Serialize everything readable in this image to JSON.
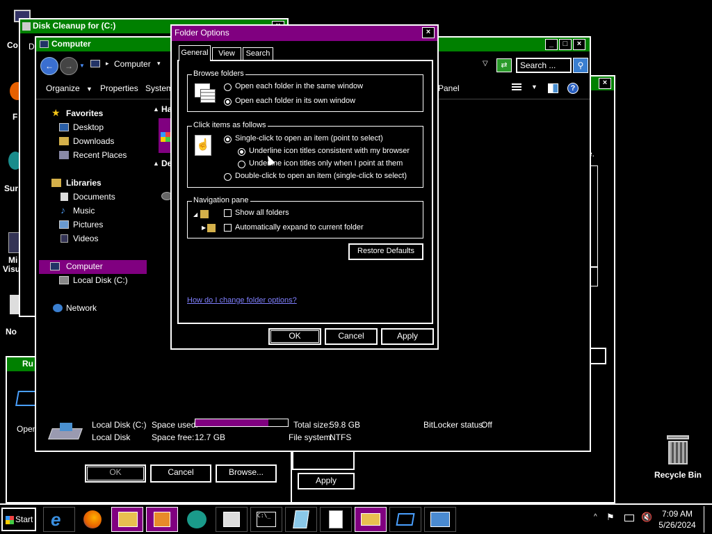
{
  "desktop": {
    "recycle_bin_label": "Recycle Bin",
    "left_icon_fragments": [
      "Co",
      "F",
      "Sur",
      "Mi",
      "Visu",
      "No"
    ]
  },
  "disk_cleanup": {
    "title": "Disk Cleanup for  (C:)",
    "fragment_d": "D"
  },
  "run_dialog": {
    "title": "Ru",
    "open_label": "Open",
    "ok_label": "OK",
    "cancel_label": "Cancel",
    "browse_label": "Browse..."
  },
  "behind_dialog": {
    "apply_label": "Apply",
    "fragment_e": "e."
  },
  "explorer": {
    "title": "Computer",
    "address_label": "Computer",
    "search_placeholder": "Search ...",
    "toolbar": {
      "organize": "Organize",
      "properties": "Properties",
      "system": "System",
      "control_panel_fragment": "l Panel"
    },
    "nav": {
      "favorites": "Favorites",
      "desktop": "Desktop",
      "downloads": "Downloads",
      "recent_places": "Recent Places",
      "libraries": "Libraries",
      "documents": "Documents",
      "music": "Music",
      "pictures": "Pictures",
      "videos": "Videos",
      "computer": "Computer",
      "local_disk": "Local Disk (C:)",
      "network": "Network"
    },
    "content_fragments": {
      "ha": "Ha",
      "de": "De"
    },
    "details": {
      "drive_name": "Local Disk (C:)",
      "drive_type": "Local Disk",
      "space_used_label": "Space used:",
      "space_free_label": "Space free:",
      "space_free_value": "12.7 GB",
      "total_size_label": "Total size:",
      "total_size_value": "59.8 GB",
      "file_system_label": "File system:",
      "file_system_value": "NTFS",
      "bitlocker_label": "BitLocker status:",
      "bitlocker_value": "Off",
      "used_fraction": 0.79
    }
  },
  "folder_options": {
    "title": "Folder Options",
    "tabs": [
      "General",
      "View",
      "Search"
    ],
    "browse_folders": {
      "label": "Browse folders",
      "opt_same": "Open each folder in the same window",
      "opt_own": "Open each folder in its own window"
    },
    "click_items": {
      "label": "Click items as follows",
      "opt_single": "Single-click to open an item (point to select)",
      "opt_underline_consistent": "Underline icon titles consistent with my browser",
      "opt_underline_point": "Underline icon titles only when I point at them",
      "opt_double": "Double-click to open an item (single-click to select)"
    },
    "navigation_pane": {
      "label": "Navigation pane",
      "show_all": "Show all folders",
      "auto_expand": "Automatically expand to current folder"
    },
    "restore_defaults": "Restore Defaults",
    "help_link": "How do I change folder options?",
    "ok": "OK",
    "cancel": "Cancel",
    "apply": "Apply"
  },
  "taskbar": {
    "start_label": "Start",
    "time": "7:09 AM",
    "date": "5/26/2024"
  },
  "colors": {
    "accent_purple": "#800080",
    "accent_green": "#008000",
    "link": "#8080ff"
  }
}
